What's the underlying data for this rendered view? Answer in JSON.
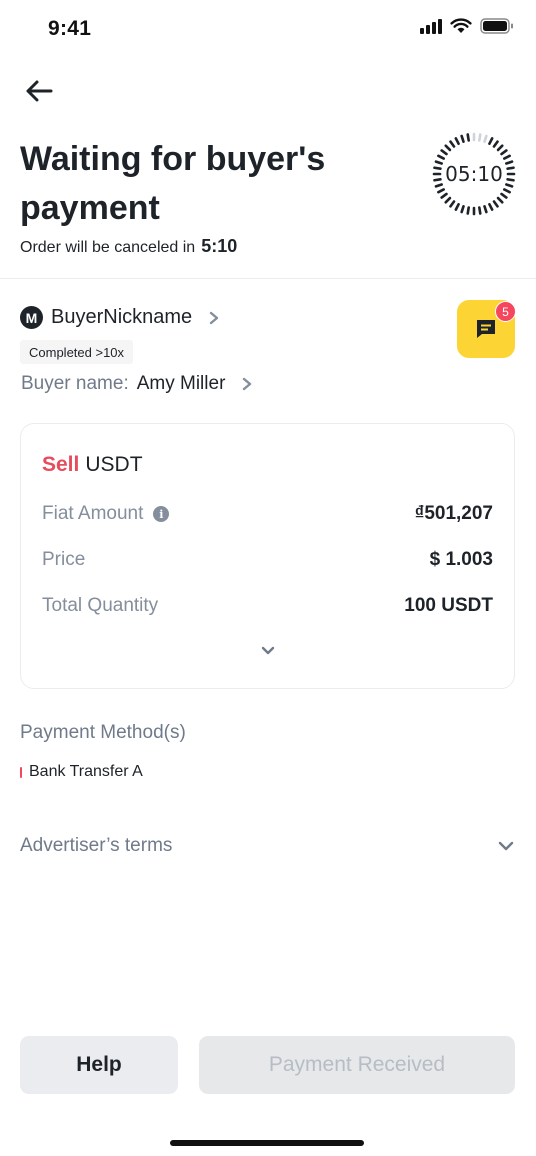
{
  "status_bar": {
    "time": "9:41"
  },
  "header": {
    "title": "Waiting for buyer's payment",
    "cancel_prefix": "Order will be canceled in",
    "cancel_time": "5:10",
    "timer": "05:10"
  },
  "buyer": {
    "avatar_letter": "M",
    "nickname": "BuyerNickname",
    "completed_badge": "Completed >10x",
    "name_label": "Buyer name:",
    "name_value": "Amy Miller"
  },
  "chat": {
    "unread_count": "5"
  },
  "order": {
    "side": "Sell",
    "asset": "USDT",
    "rows": [
      {
        "label": "Fiat Amount",
        "value": "₫501,207"
      },
      {
        "label": "Price",
        "value": "$ 1.003"
      },
      {
        "label": "Total Quantity",
        "value": "100 USDT"
      }
    ]
  },
  "payment": {
    "heading": "Payment Method(s)",
    "methods": [
      "Bank Transfer A"
    ]
  },
  "terms": {
    "label": "Advertiser’s terms"
  },
  "actions": {
    "help_label": "Help",
    "received_label": "Payment Received"
  },
  "colors": {
    "sell_red": "#e74c5c",
    "chat_yellow": "#fcd535",
    "badge_red": "#f6465d",
    "disabled_text": "#b7bdc6"
  },
  "icons": [
    "back-arrow-icon",
    "chevron-right-icon",
    "info-icon",
    "chevron-down-icon",
    "chat-icon",
    "signal-icon",
    "wifi-icon",
    "battery-icon"
  ]
}
